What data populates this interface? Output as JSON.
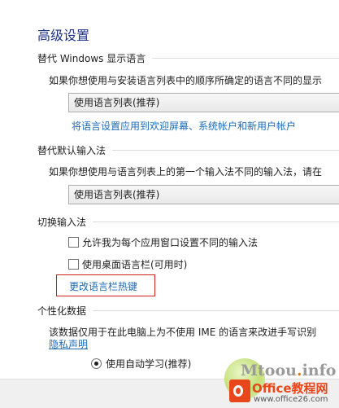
{
  "page": {
    "title": "高级设置"
  },
  "display_language": {
    "header": "替代 Windows 显示语言",
    "description": "如果你想使用与安装语言列表中的顺序所确定的语言不同的显示",
    "select_value": "使用语言列表(推荐)",
    "apply_link": "将语言设置应用到欢迎屏幕、系统帐户和新用户帐户"
  },
  "input_method": {
    "header": "替代默认输入法",
    "description": "如果你想使用与语言列表上的第一个输入法不同的输入法，请在",
    "select_value": "使用语言列表(推荐)"
  },
  "switch_input": {
    "header": "切换输入法",
    "per_app_checkbox": "允许我为每个应用窗口设置不同的输入法",
    "per_app_checked": false,
    "desktop_bar_checkbox": "使用桌面语言栏(可用时)",
    "desktop_bar_checked": false,
    "hotkeys_link": "更改语言栏热键"
  },
  "personalization": {
    "header": "个性化数据",
    "description": "该数据仅用于在此电脑上为不使用 IME 的语言来改进手写识别",
    "privacy_link": "隐私声明",
    "radio_label": "使用自动学习(推荐)",
    "radio_selected": true
  },
  "watermark": {
    "site_text": "Mtoou",
    "site_dot": ".",
    "site_suffix": "info",
    "brand": "Office教程网",
    "url": "www.office26.com"
  },
  "colors": {
    "title": "#1e3287",
    "link": "#1e6ab5",
    "highlight": "#d22020",
    "office_brand": "#e8471b"
  }
}
